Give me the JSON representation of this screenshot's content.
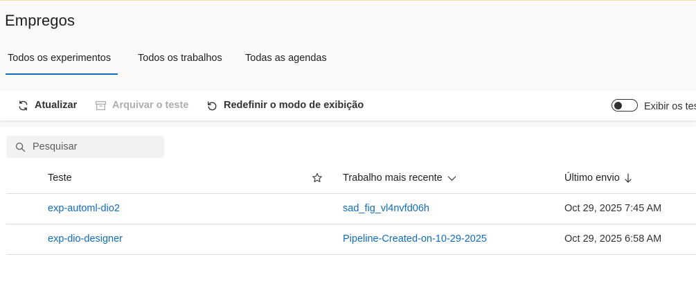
{
  "page": {
    "title": "Empregos"
  },
  "tabs": [
    {
      "label": "Todos os experimentos",
      "active": true
    },
    {
      "label": "Todos os trabalhos",
      "active": false
    },
    {
      "label": "Todas as agendas",
      "active": false
    }
  ],
  "toolbar": {
    "refresh_label": "Atualizar",
    "archive_label": "Arquivar o teste",
    "reset_view_label": "Redefinir o modo de exibição",
    "toggle_label": "Exibir os tes"
  },
  "search": {
    "placeholder": "Pesquisar",
    "value": ""
  },
  "table": {
    "columns": {
      "experiment": "Teste",
      "latest_job": "Trabalho mais recente",
      "last_submitted": "Último envio"
    },
    "rows": [
      {
        "experiment": "exp-automl-dio2",
        "latest_job": "sad_fig_vl4nvfd06h",
        "last_submitted": "Oct 29, 2025 7:45 AM"
      },
      {
        "experiment": "exp-dio-designer",
        "latest_job": "Pipeline-Created-on-10-29-2025",
        "last_submitted": "Oct 29, 2025 6:58 AM"
      }
    ]
  },
  "colors": {
    "accent": "#0f6cbd",
    "link": "#0f6cbd",
    "disabled": "#b0adab"
  },
  "icons": [
    "refresh-icon",
    "archive-icon",
    "reset-icon",
    "search-icon",
    "star-icon",
    "chevron-down-icon",
    "sort-down-arrow-icon"
  ]
}
